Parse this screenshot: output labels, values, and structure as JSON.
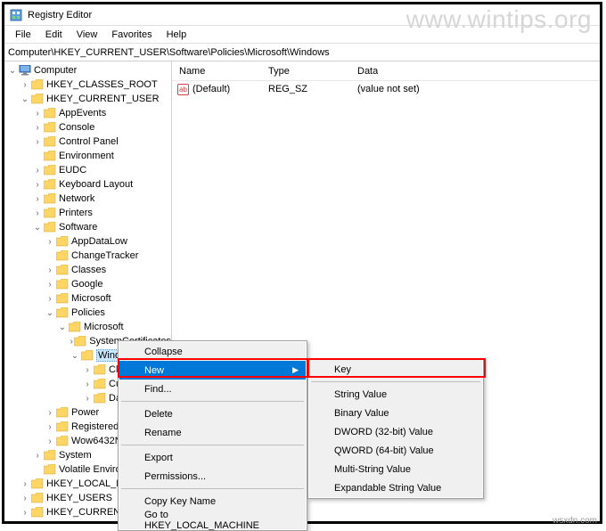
{
  "watermark": "www.wintips.org",
  "credit": "wsxdn.com",
  "titlebar": {
    "title": "Registry Editor"
  },
  "menubar": {
    "file": "File",
    "edit": "Edit",
    "view": "View",
    "favorites": "Favorites",
    "help": "Help"
  },
  "addrbar": {
    "path": "Computer\\HKEY_CURRENT_USER\\Software\\Policies\\Microsoft\\Windows"
  },
  "columns": {
    "name": "Name",
    "type": "Type",
    "data_h": "Data"
  },
  "valueRow": {
    "name": "(Default)",
    "type": "REG_SZ",
    "data": "(value not set)"
  },
  "tree": {
    "root": "Computer",
    "hkcr": "HKEY_CLASSES_ROOT",
    "hkcu": "HKEY_CURRENT_USER",
    "appevents": "AppEvents",
    "console": "Console",
    "controlpanel": "Control Panel",
    "environment": "Environment",
    "eudc": "EUDC",
    "keyboard": "Keyboard Layout",
    "network": "Network",
    "printers": "Printers",
    "software": "Software",
    "appdatalow": "AppDataLow",
    "changetracker": "ChangeTracker",
    "classes": "Classes",
    "google": "Google",
    "microsoft": "Microsoft",
    "policies": "Policies",
    "pmicrosoft": "Microsoft",
    "syscert": "SystemCertificates",
    "windows": "Windows",
    "cl": "Cl",
    "cu": "Cu",
    "da": "Da",
    "power": "Power",
    "registered": "RegisteredA",
    "wow6432": "Wow6432N",
    "system": "System",
    "volatile": "Volatile Enviro",
    "hklm": "HKEY_LOCAL_MA",
    "hku": "HKEY_USERS",
    "hkcc": "HKEY_CURRENT_"
  },
  "ctx1": {
    "collapse": "Collapse",
    "new": "New",
    "find": "Find...",
    "delete": "Delete",
    "rename": "Rename",
    "export": "Export",
    "permissions": "Permissions...",
    "copykey": "Copy Key Name",
    "goto": "Go to HKEY_LOCAL_MACHINE"
  },
  "ctx2": {
    "key": "Key",
    "string": "String Value",
    "binary": "Binary Value",
    "dword": "DWORD (32-bit) Value",
    "qword": "QWORD (64-bit) Value",
    "multi": "Multi-String Value",
    "expand": "Expandable String Value"
  }
}
